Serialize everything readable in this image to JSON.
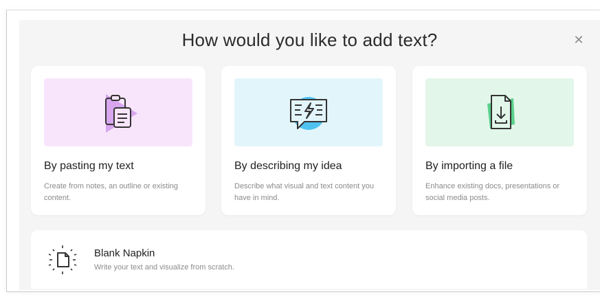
{
  "dialog": {
    "title": "How would you like to add text?",
    "close_icon": "close-icon"
  },
  "options": [
    {
      "title": "By pasting my text",
      "description": "Create from notes, an outline or existing content.",
      "icon": "clipboard-paste-icon",
      "background": "#f8e5fc",
      "accent": "#d7a6ef"
    },
    {
      "title": "By describing my idea",
      "description": "Describe what visual and text content you have in mind.",
      "icon": "idea-speech-bubble-icon",
      "background": "#e2f5fb",
      "accent": "#4fc3f0"
    },
    {
      "title": "By importing a file",
      "description": "Enhance existing docs, presentations or social media posts.",
      "icon": "file-import-icon",
      "background": "#e2f6ea",
      "accent": "#5ad08a"
    }
  ],
  "blank": {
    "title": "Blank Napkin",
    "description": "Write your text and visualize from scratch.",
    "icon": "blank-page-sparkle-icon"
  },
  "colors": {
    "dialog_background": "#f5f5f5",
    "card_background": "#ffffff",
    "title_text": "#2b2b2b",
    "muted_text": "#8a8a8a"
  }
}
